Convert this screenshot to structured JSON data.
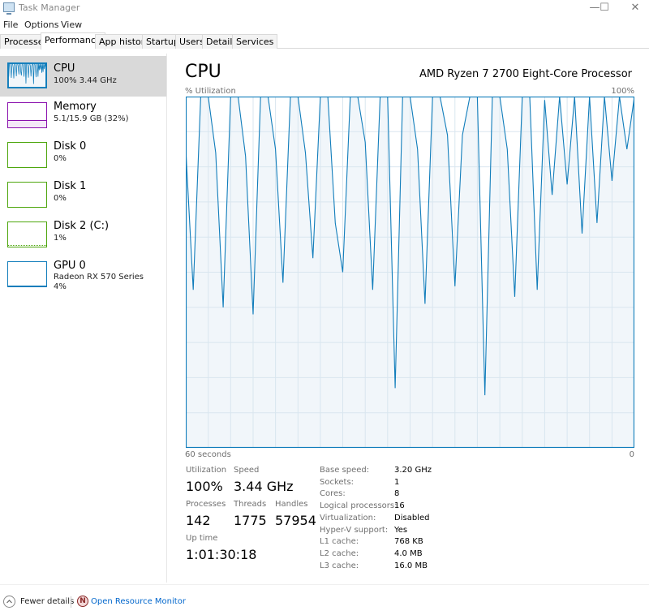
{
  "window": {
    "title": "Task Manager",
    "controls": {
      "minimize": "—",
      "maximize": "☐",
      "close": "✕"
    }
  },
  "menu": [
    "File",
    "Options",
    "View"
  ],
  "tabs": [
    {
      "label": "Processes",
      "active": false
    },
    {
      "label": "Performance",
      "active": true
    },
    {
      "label": "App history",
      "active": false
    },
    {
      "label": "Startup",
      "active": false
    },
    {
      "label": "Users",
      "active": false
    },
    {
      "label": "Details",
      "active": false
    },
    {
      "label": "Services",
      "active": false
    }
  ],
  "sidebar": {
    "items": [
      {
        "title": "CPU",
        "sub": "100%  3.44 GHz",
        "sub2": "",
        "color": "#117dbb",
        "active": true
      },
      {
        "title": "Memory",
        "sub": "5.1/15.9 GB (32%)",
        "sub2": "",
        "color": "#8b12ae",
        "active": false
      },
      {
        "title": "Disk 0",
        "sub": "0%",
        "sub2": "",
        "color": "#4da60c",
        "active": false
      },
      {
        "title": "Disk 1",
        "sub": "0%",
        "sub2": "",
        "color": "#4da60c",
        "active": false
      },
      {
        "title": "Disk 2 (C:)",
        "sub": "1%",
        "sub2": "",
        "color": "#4da60c",
        "active": false
      },
      {
        "title": "GPU 0",
        "sub": "Radeon RX 570 Series",
        "sub2": "4%",
        "color": "#117dbb",
        "active": false
      }
    ]
  },
  "main": {
    "title": "CPU",
    "processor": "AMD Ryzen 7 2700 Eight-Core Processor",
    "graph_label_left": "% Utilization",
    "graph_label_right": "100%",
    "graph_bottom_left": "60 seconds",
    "graph_bottom_right": "0",
    "stats": {
      "utilization_label": "Utilization",
      "utilization": "100%",
      "speed_label": "Speed",
      "speed": "3.44 GHz",
      "processes_label": "Processes",
      "processes": "142",
      "threads_label": "Threads",
      "threads": "1775",
      "handles_label": "Handles",
      "handles": "57954",
      "uptime_label": "Up time",
      "uptime": "1:01:30:18"
    },
    "details": [
      {
        "label": "Base speed:",
        "value": "3.20 GHz"
      },
      {
        "label": "Sockets:",
        "value": "1"
      },
      {
        "label": "Cores:",
        "value": "8"
      },
      {
        "label": "Logical processors:",
        "value": "16"
      },
      {
        "label": "Virtualization:",
        "value": "Disabled"
      },
      {
        "label": "Hyper-V support:",
        "value": "Yes"
      },
      {
        "label": "L1 cache:",
        "value": "768 KB"
      },
      {
        "label": "L2 cache:",
        "value": "4.0 MB"
      },
      {
        "label": "L3 cache:",
        "value": "16.0 MB"
      }
    ]
  },
  "footer": {
    "fewer_details": "Fewer details",
    "open_resource_monitor": "Open Resource Monitor",
    "link_color": "#0066cc"
  },
  "chart_data": {
    "type": "line",
    "title": "CPU",
    "ylabel": "% Utilization",
    "xlabel": "60 seconds",
    "xlim": [
      60,
      0
    ],
    "ylim": [
      0,
      100
    ],
    "grid": true,
    "color": "#117dbb",
    "fill": "#f1f6fa",
    "x": [
      60,
      59,
      58,
      57,
      56,
      55,
      54,
      53,
      52,
      51,
      50,
      49,
      48,
      47,
      46,
      45,
      44,
      43,
      42,
      41,
      40,
      39,
      38,
      37,
      36,
      35,
      34,
      33,
      32,
      31,
      30,
      29,
      28,
      27,
      26,
      25,
      24,
      23,
      22,
      21,
      20,
      19,
      18,
      17,
      16,
      15,
      14,
      13,
      12,
      11,
      10,
      9,
      8,
      7,
      6,
      5,
      4,
      3,
      2,
      1,
      0
    ],
    "values": [
      85,
      45,
      100,
      100,
      84,
      40,
      100,
      100,
      83,
      38,
      100,
      100,
      85,
      47,
      100,
      100,
      84,
      54,
      100,
      100,
      64,
      50,
      100,
      100,
      87,
      45,
      100,
      100,
      17,
      100,
      100,
      85,
      41,
      100,
      100,
      89,
      46,
      89,
      100,
      100,
      15,
      100,
      100,
      85,
      43,
      100,
      100,
      45,
      99,
      72,
      100,
      75,
      100,
      61,
      100,
      64,
      100,
      76,
      100,
      85,
      100
    ]
  }
}
